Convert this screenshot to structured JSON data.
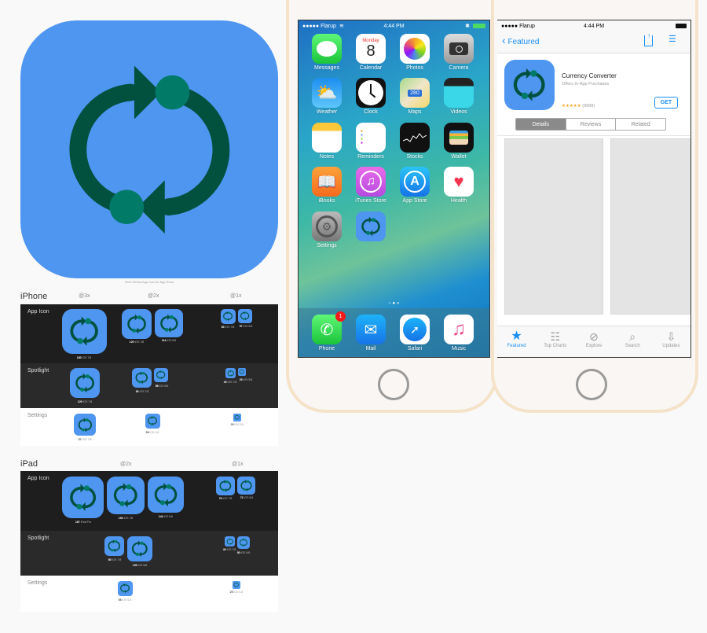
{
  "icon_sheet": {
    "hero_caption": "1024 Retina App Icon for App Store",
    "iphone": {
      "title": "iPhone",
      "columns": [
        "@3x",
        "@2x",
        "@1x"
      ],
      "rows": [
        {
          "label": "App Icon",
          "sizes": [
            {
              "px": "180",
              "note": "iOS 7/8"
            },
            {
              "px": "120",
              "note": "iOS 7/8"
            },
            {
              "px": "114",
              "note": "iOS 5/6"
            },
            {
              "px": "60",
              "note": "iOS 7/8"
            },
            {
              "px": "57",
              "note": "iOS 5/6"
            }
          ]
        },
        {
          "label": "Spotlight",
          "sizes": [
            {
              "px": "120",
              "note": "iOS 7/8"
            },
            {
              "px": "80",
              "note": "iOS 7/8"
            },
            {
              "px": "58",
              "note": "iOS 5/6"
            },
            {
              "px": "40",
              "note": "iOS 7/8"
            },
            {
              "px": "29",
              "note": "iOS 5/6"
            }
          ]
        },
        {
          "label": "Settings",
          "sizes": [
            {
              "px": "87",
              "note": "iOS 7/8"
            },
            {
              "px": "58",
              "note": "iOS 5-8"
            },
            {
              "px": "29",
              "note": "iOS 5-8"
            }
          ]
        }
      ]
    },
    "ipad": {
      "title": "iPad",
      "columns": [
        "@2x",
        "@1x"
      ],
      "rows": [
        {
          "label": "App Icon",
          "sizes": [
            {
              "px": "167",
              "note": "iPad Pro"
            },
            {
              "px": "152",
              "note": "iOS 7/8"
            },
            {
              "px": "144",
              "note": "iOS 5/6"
            },
            {
              "px": "76",
              "note": "iOS 7/8"
            },
            {
              "px": "72",
              "note": "iOS 5/6"
            }
          ]
        },
        {
          "label": "Spotlight",
          "sizes": [
            {
              "px": "80",
              "note": "iOS 7/8"
            },
            {
              "px": "100",
              "note": "iOS 5/6"
            },
            {
              "px": "40",
              "note": "iOS 7/8"
            },
            {
              "px": "50",
              "note": "iOS 5/6"
            }
          ]
        },
        {
          "label": "Settings",
          "sizes": [
            {
              "px": "58",
              "note": "iOS 5-8"
            },
            {
              "px": "29",
              "note": "iOS 5-8"
            }
          ]
        }
      ]
    }
  },
  "home_screen": {
    "carrier": "●●●●● Flarup",
    "time": "4:44 PM",
    "apps": [
      {
        "label": "Messages",
        "icon": "messages-icon"
      },
      {
        "label": "Calendar",
        "icon": "calendar-icon",
        "day": "Monday",
        "date": "8"
      },
      {
        "label": "Photos",
        "icon": "photos-icon"
      },
      {
        "label": "Camera",
        "icon": "camera-icon"
      },
      {
        "label": "Weather",
        "icon": "weather-icon"
      },
      {
        "label": "Clock",
        "icon": "clock-icon"
      },
      {
        "label": "Maps",
        "icon": "maps-icon",
        "shield": "280"
      },
      {
        "label": "Videos",
        "icon": "videos-icon"
      },
      {
        "label": "Notes",
        "icon": "notes-icon"
      },
      {
        "label": "Reminders",
        "icon": "reminders-icon"
      },
      {
        "label": "Stocks",
        "icon": "stocks-icon"
      },
      {
        "label": "Wallet",
        "icon": "wallet-icon"
      },
      {
        "label": "iBooks",
        "icon": "ibooks-icon"
      },
      {
        "label": "iTunes Store",
        "icon": "itunes-icon"
      },
      {
        "label": "App Store",
        "icon": "appstore-icon"
      },
      {
        "label": "Health",
        "icon": "health-icon"
      },
      {
        "label": "Settings",
        "icon": "settings-icon"
      },
      {
        "label": "",
        "icon": "currency-converter-icon"
      }
    ],
    "dock": [
      {
        "label": "Phone",
        "icon": "phone-icon",
        "badge": "1"
      },
      {
        "label": "Mail",
        "icon": "mail-icon"
      },
      {
        "label": "Safari",
        "icon": "safari-icon"
      },
      {
        "label": "Music",
        "icon": "music-icon"
      }
    ],
    "page_count": 2,
    "current_page": 1
  },
  "app_store": {
    "carrier": "●●●●● Flarup",
    "time": "4:44 PM",
    "back_label": "Featured",
    "app_name": "Currency Converter",
    "subtitle": "Offers In-App Purchases",
    "stars": "★★★★★",
    "rating_count": "(9999)",
    "get_label": "GET",
    "segments": [
      "Details",
      "Reviews",
      "Related"
    ],
    "active_segment": "Details",
    "tabs": [
      "Featured",
      "Top Charts",
      "Explore",
      "Search",
      "Updates"
    ],
    "active_tab": "Featured",
    "accent": "#1a8ff7"
  },
  "colors": {
    "icon_bg": "#4e96f0",
    "arrow": "#02513f",
    "dot": "#017b68"
  }
}
